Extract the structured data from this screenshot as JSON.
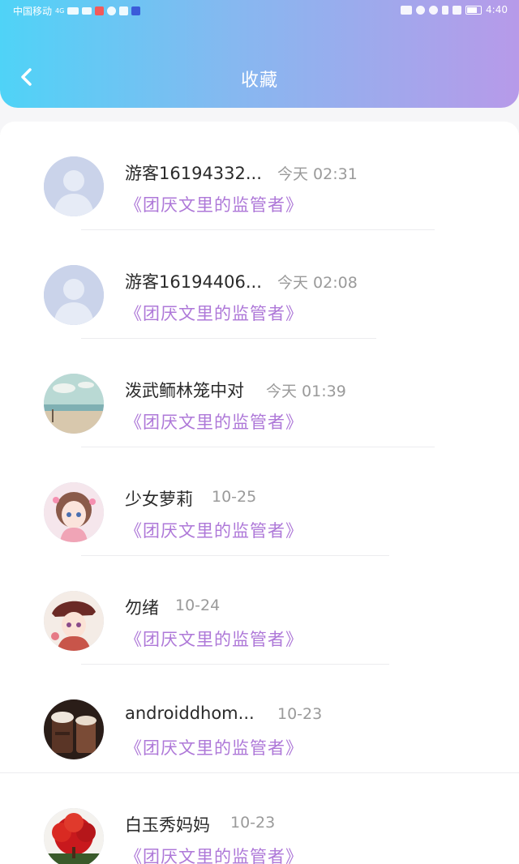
{
  "status_bar": {
    "carrier": "中国移动",
    "network": "4G",
    "time": "4:40"
  },
  "header": {
    "title": "收藏"
  },
  "favorites": [
    {
      "name": "游客16194332...",
      "time": "今天 02:31",
      "work": "《团厌文里的监管者》",
      "avatar": "default-avatar"
    },
    {
      "name": "游客16194406...",
      "time": "今天 02:08",
      "work": "《团厌文里的监管者》",
      "avatar": "default-avatar"
    },
    {
      "name": "泼武鲕林笼中对",
      "time": "今天 01:39",
      "work": "《团厌文里的监管者》",
      "avatar": "beach-scenery-avatar"
    },
    {
      "name": "少女萝莉",
      "time": "10-25",
      "work": "《团厌文里的监管者》",
      "avatar": "anime-girl-avatar"
    },
    {
      "name": "勿绪",
      "time": "10-24",
      "work": "《团厌文里的监管者》",
      "avatar": "anime-girl-hat-avatar"
    },
    {
      "name": "androiddhom...",
      "time": "10-23",
      "work": "《团厌文里的监管者》",
      "avatar": "chocolate-drink-avatar"
    },
    {
      "name": "白玉秀妈妈",
      "time": "10-23",
      "work": "《团厌文里的监管者》",
      "avatar": "red-tree-avatar"
    }
  ],
  "colors": {
    "header_gradient": [
      "#4fd3f7",
      "#86b8f0",
      "#b79ae9"
    ],
    "work_title": "#ae78d8",
    "time_text": "#9a9a9a"
  }
}
